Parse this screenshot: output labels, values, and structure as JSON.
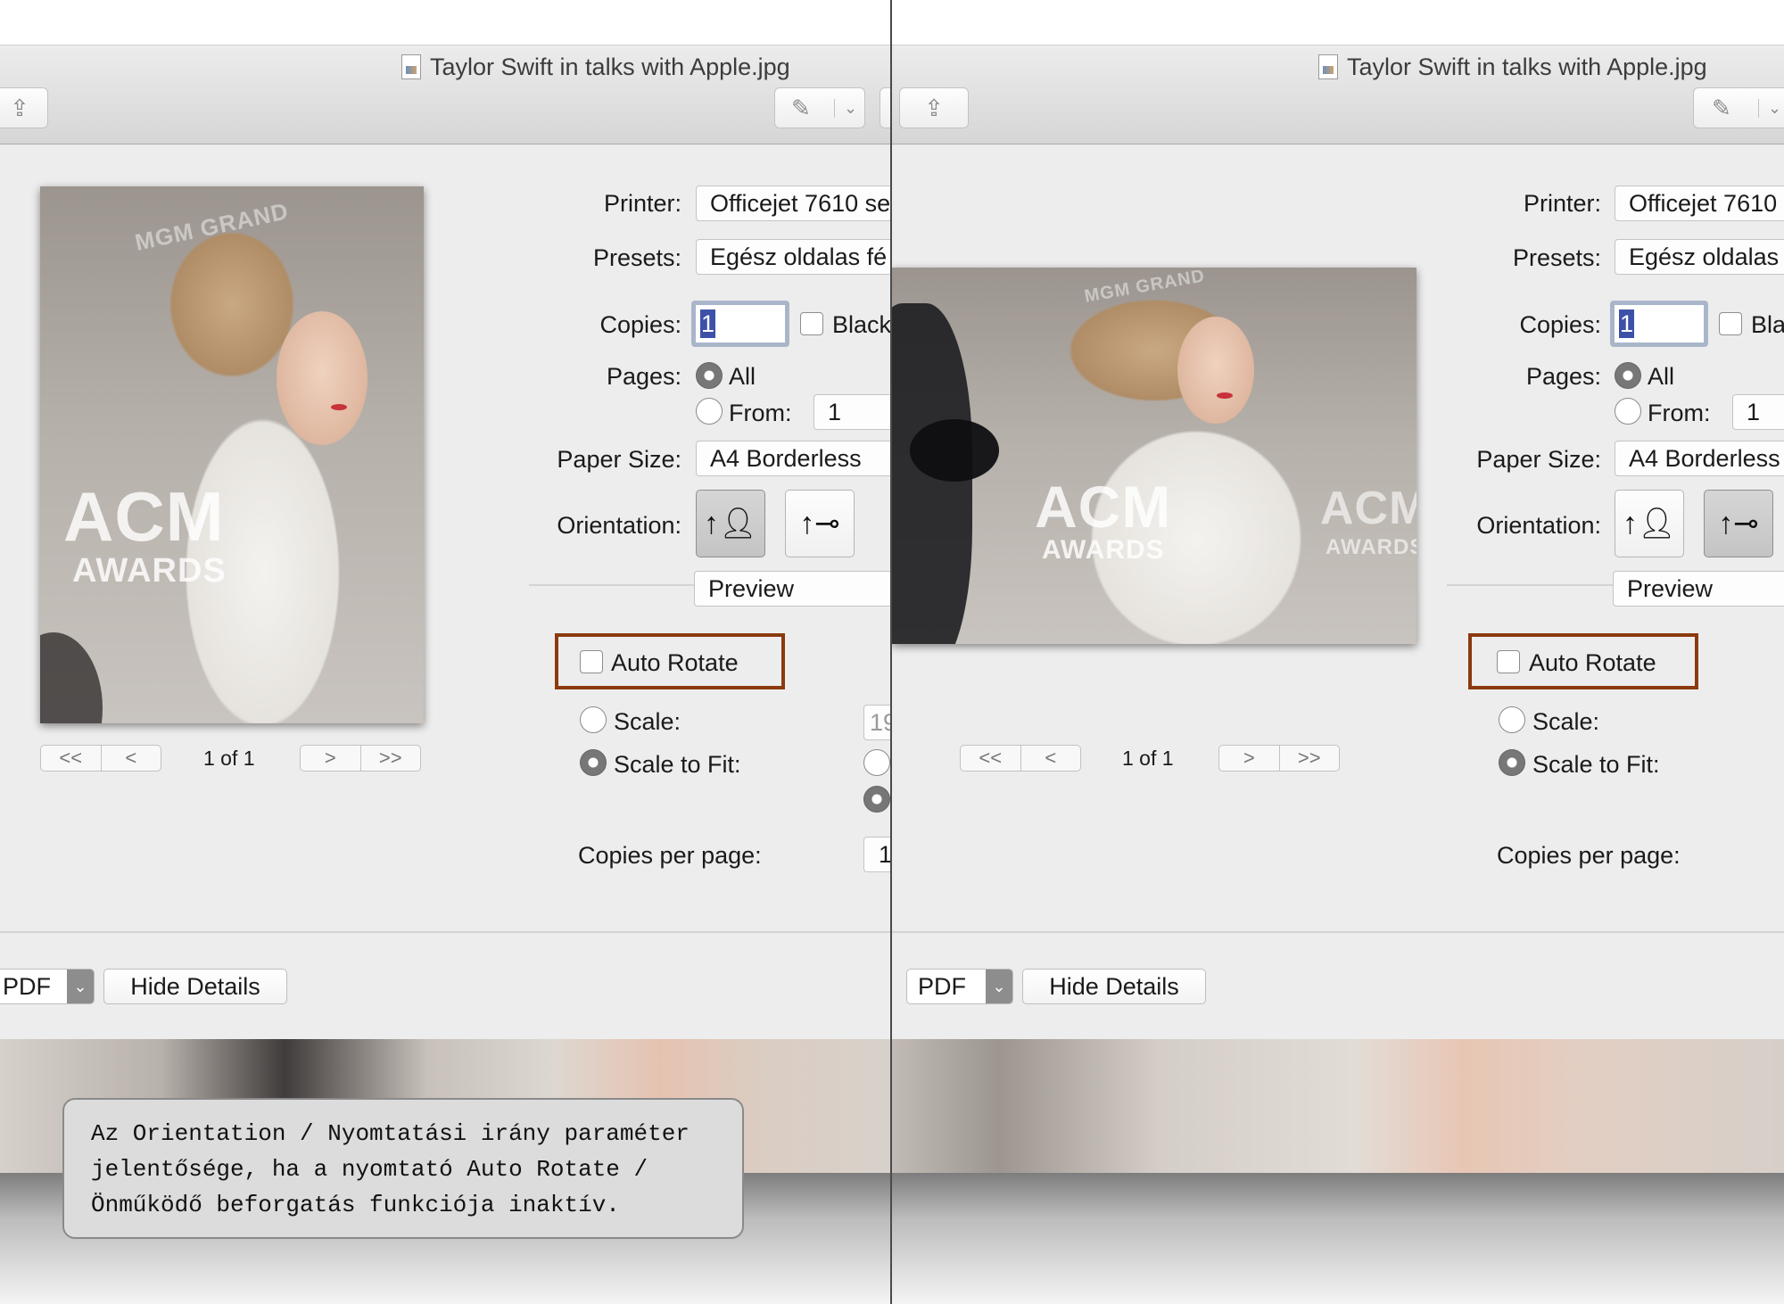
{
  "window": {
    "title": "Taylor Swift in talks with Apple.jpg",
    "share_icon": "share-icon",
    "markup_icon": "markup-pen-icon"
  },
  "labels": {
    "printer": "Printer:",
    "presets": "Presets:",
    "copies": "Copies:",
    "pages": "Pages:",
    "all": "All",
    "from": "From:",
    "paper_size": "Paper Size:",
    "orientation": "Orientation:",
    "auto_rotate": "Auto Rotate",
    "scale": "Scale:",
    "scale_to_fit": "Scale to Fit:",
    "copies_per_page": "Copies per page:"
  },
  "image_logo": {
    "brand": "MGM GRAND",
    "acm": "ACM",
    "awards": "AWARDS"
  },
  "left": {
    "printer_value": "Officejet 7610 se",
    "presets_value": "Egész oldalas fé",
    "copies_value": "1",
    "black_label": "Black",
    "from_value": "1",
    "paper_size_value": "A4 Borderless",
    "section_value": "Preview",
    "scale_value": "19",
    "copies_per_page_value": "1",
    "page_indicator": "1 of 1",
    "auto_rotate_checked": false,
    "scale_to_fit_selected": true,
    "orientation": "portrait"
  },
  "right": {
    "printer_value": "Officejet 7610",
    "presets_value": "Egész oldalas",
    "copies_value": "1",
    "black_label": "Bla",
    "from_value": "1",
    "paper_size_value": "A4 Borderless",
    "section_value": "Preview",
    "page_indicator": "1 of 1",
    "auto_rotate_checked": false,
    "scale_to_fit_selected": true,
    "orientation": "landscape"
  },
  "pager": {
    "first": "<<",
    "prev": "<",
    "next": ">",
    "last": ">>"
  },
  "footer": {
    "pdf_label": "PDF",
    "hide_details_label": "Hide Details"
  },
  "caption": "Az Orientation / Nyomtatási irány paraméter\njelentősége, ha a nyomtató Auto Rotate /\nÖnműködő beforgatás funkciója inaktív.",
  "colors": {
    "highlight_border": "#8b3a0e",
    "selection": "#3d51a8",
    "sheet_bg": "#ededed"
  }
}
